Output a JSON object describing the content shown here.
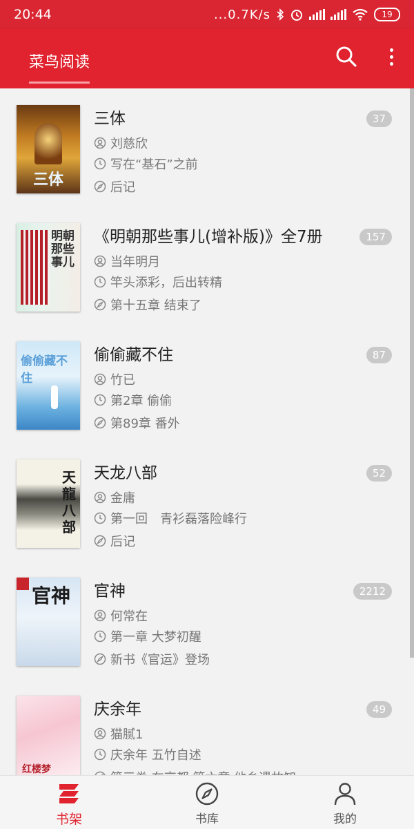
{
  "status_bar": {
    "time": "20:44",
    "network_speed": "...0.7K/s",
    "battery": "19"
  },
  "app_bar": {
    "title": "菜鸟阅读",
    "search_icon": "search-icon",
    "more_icon": "more-vert-icon"
  },
  "books": [
    {
      "title": "三体",
      "author": "刘慈欣",
      "recent_chapter": "写在“基石”之前",
      "latest_chapter": "后记",
      "badge": "37",
      "cover_text": "三体"
    },
    {
      "title": "《明朝那些事儿(增补版)》全7册",
      "author": "当年明月",
      "recent_chapter": "竿头添彩，后出转精",
      "latest_chapter": "第十五章 结束了",
      "badge": "157",
      "cover_text": "明朝那些事儿"
    },
    {
      "title": "偷偷藏不住",
      "author": "竹已",
      "recent_chapter": "第2章 偷偷",
      "latest_chapter": "第89章 番外",
      "badge": "87",
      "cover_text": "偷偷藏不住"
    },
    {
      "title": "天龙八部",
      "author": "金庸",
      "recent_chapter": "第一回　青衫磊落险峰行",
      "latest_chapter": "后记",
      "badge": "52",
      "cover_text": "天龍八部"
    },
    {
      "title": "官神",
      "author": "何常在",
      "recent_chapter": "第一章 大梦初醒",
      "latest_chapter": "新书《官运》登场",
      "badge": "2212",
      "cover_text": "官神"
    },
    {
      "title": "庆余年",
      "author": "猫腻1",
      "recent_chapter": "庆余年 五竹自述",
      "latest_chapter": "第三卷 在京都 第六章 他乡遇故知",
      "badge": "49",
      "cover_text": "红楼梦"
    }
  ],
  "bottom_nav": [
    {
      "label": "书架",
      "icon": "bookshelf-icon",
      "active": true
    },
    {
      "label": "书库",
      "icon": "compass-icon",
      "active": false
    },
    {
      "label": "我的",
      "icon": "person-icon",
      "active": false
    }
  ],
  "colors": {
    "primary": "#e0232f",
    "status_bar": "#d92632",
    "badge": "#c9c9c9"
  }
}
